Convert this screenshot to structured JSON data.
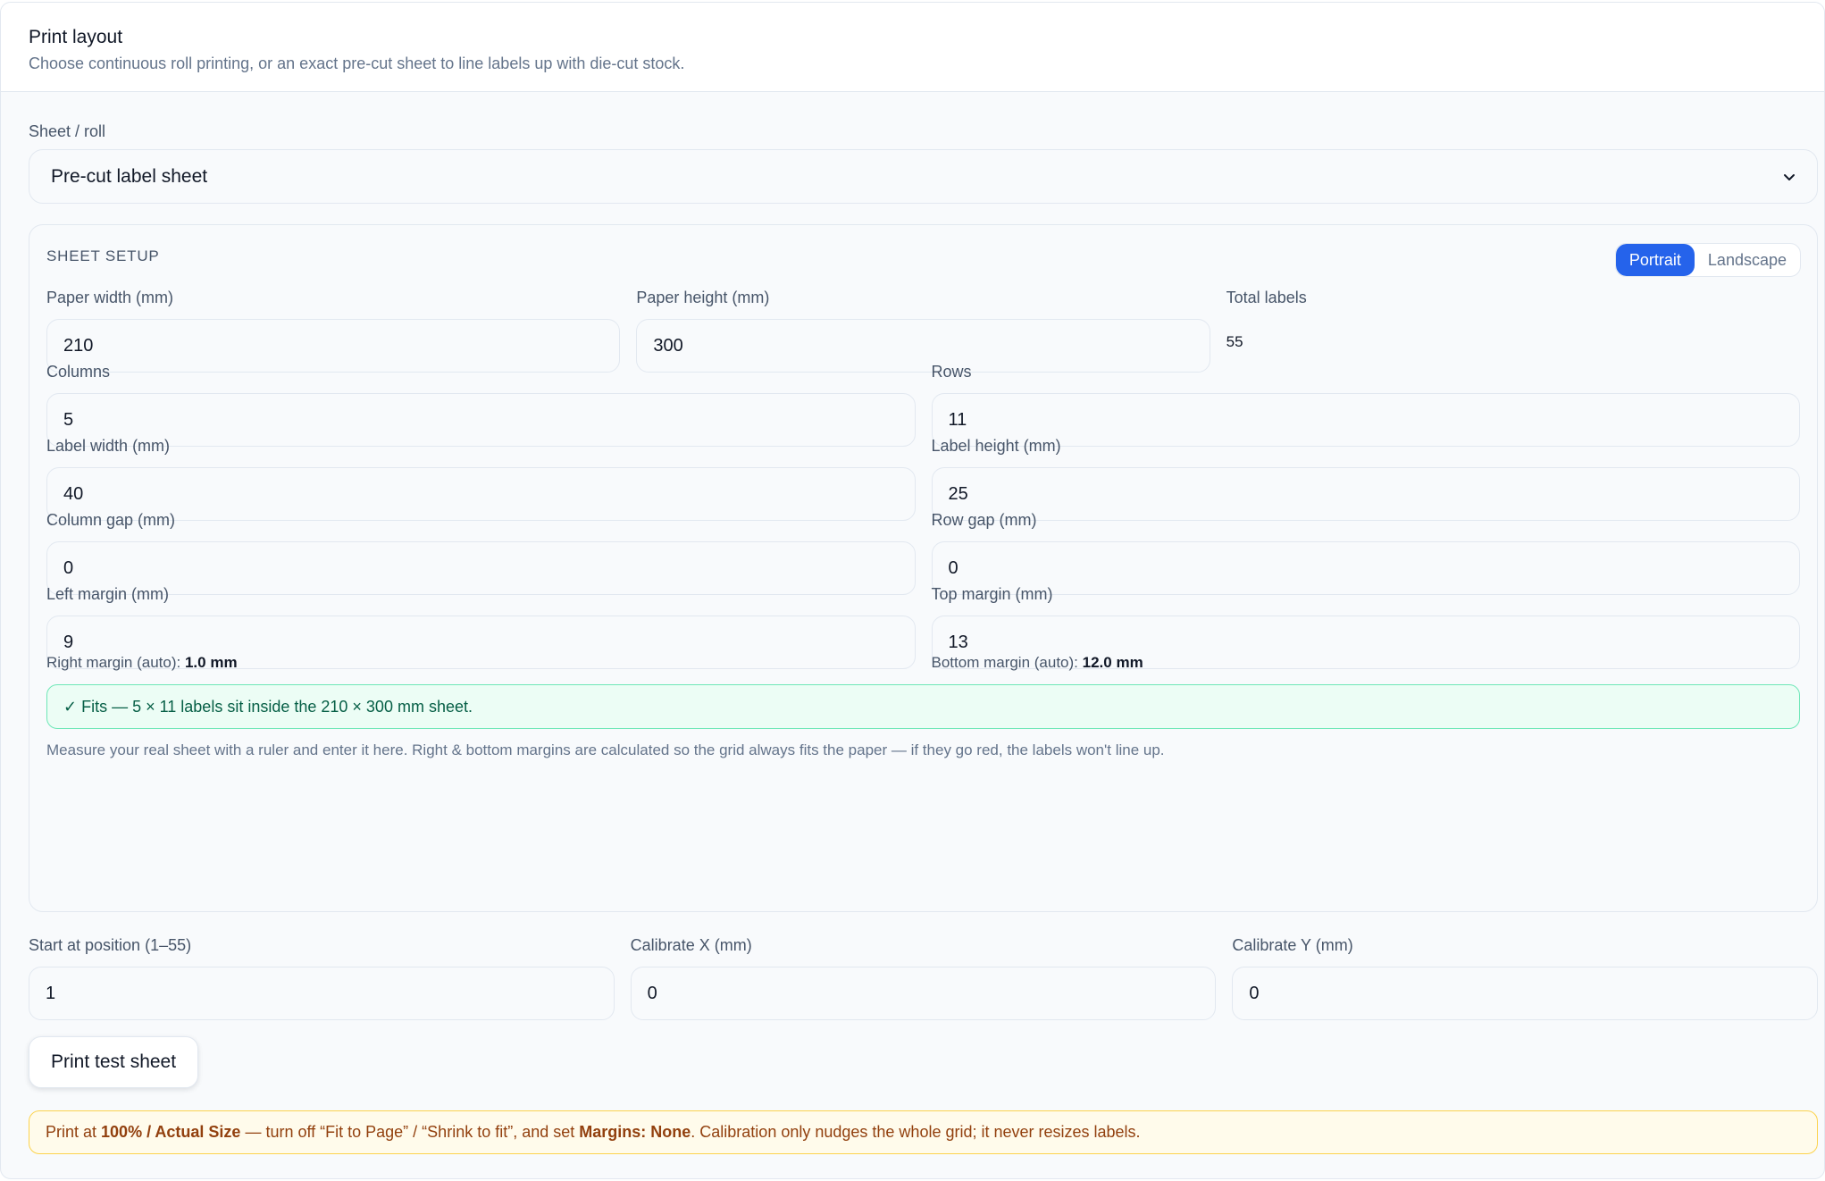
{
  "header": {
    "title": "Print layout",
    "subtitle": "Choose continuous roll printing, or an exact pre-cut sheet to line labels up with die-cut stock."
  },
  "sheet_roll": {
    "label": "Sheet / roll",
    "value": "Pre-cut label sheet"
  },
  "sheet_setup": {
    "title": "SHEET SETUP",
    "orientation": {
      "portrait": "Portrait",
      "landscape": "Landscape",
      "selected": "Portrait"
    },
    "paper_width": {
      "label": "Paper width (mm)",
      "value": "210"
    },
    "paper_height": {
      "label": "Paper height (mm)",
      "value": "300"
    },
    "total_labels": {
      "label": "Total labels",
      "value": "55"
    },
    "columns": {
      "label": "Columns",
      "value": "5"
    },
    "rows": {
      "label": "Rows",
      "value": "11"
    },
    "label_width": {
      "label": "Label width (mm)",
      "value": "40"
    },
    "label_height": {
      "label": "Label height (mm)",
      "value": "25"
    },
    "column_gap": {
      "label": "Column gap (mm)",
      "value": "0"
    },
    "row_gap": {
      "label": "Row gap (mm)",
      "value": "0"
    },
    "left_margin": {
      "label": "Left margin (mm)",
      "value": "9"
    },
    "top_margin": {
      "label": "Top margin (mm)",
      "value": "13"
    },
    "right_margin_auto": {
      "label": "Right margin (auto):",
      "value": "1.0 mm"
    },
    "bottom_margin_auto": {
      "label": "Bottom margin (auto):",
      "value": "12.0 mm"
    },
    "fits_message": "✓ Fits — 5 × 11 labels sit inside the 210 × 300 mm sheet.",
    "help_text": "Measure your real sheet with a ruler and enter it here. Right & bottom margins are calculated so the grid always fits the paper — if they go red, the labels won't line up."
  },
  "start_position": {
    "label": "Start at position (1–55)",
    "value": "1"
  },
  "calibrate_x": {
    "label": "Calibrate X (mm)",
    "value": "0"
  },
  "calibrate_y": {
    "label": "Calibrate Y (mm)",
    "value": "0"
  },
  "print_test_button": "Print test sheet",
  "warning": {
    "t1": "Print at ",
    "b1": "100% / Actual Size",
    "t2": " — turn off “Fit to Page” / “Shrink to fit”, and set ",
    "b2": "Margins: None",
    "t3": ". Calibration only nudges the whole grid; it never resizes labels."
  },
  "colors": {
    "accent": "#2563eb",
    "success_bg": "#ecfdf5",
    "success_border": "#6ee7b7",
    "warning_bg": "#fffbeb",
    "warning_border": "#fcd34d"
  }
}
